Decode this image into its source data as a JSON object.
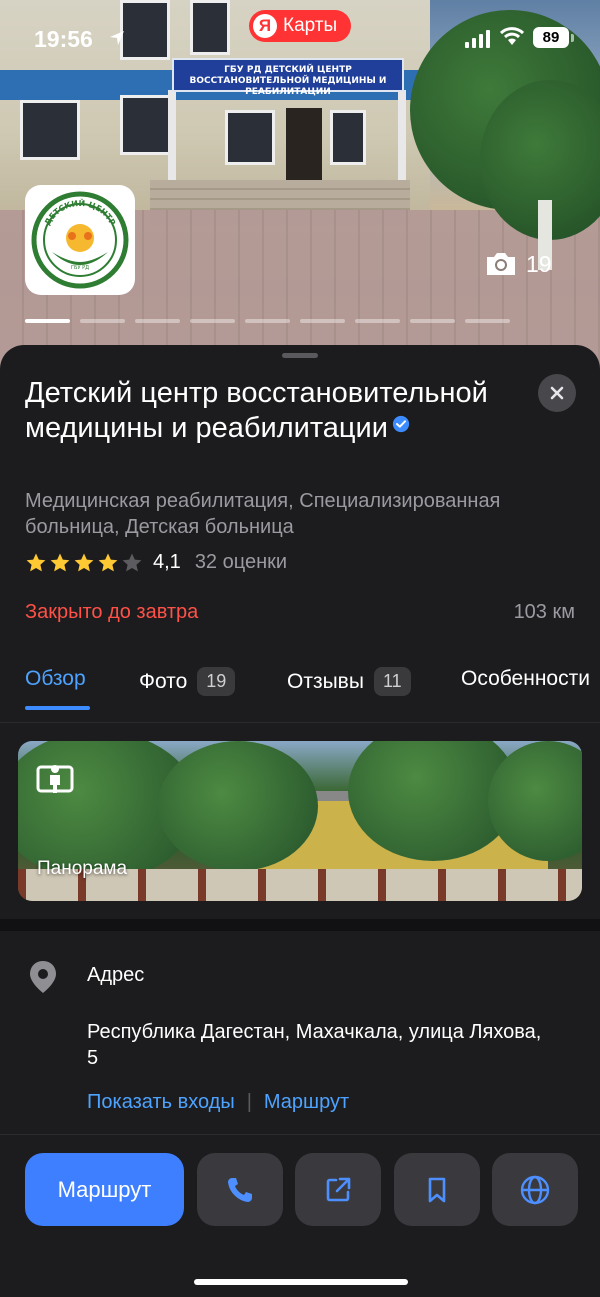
{
  "status_bar": {
    "time": "19:56",
    "app_pill": {
      "logo": "Я",
      "label": "Карты"
    },
    "battery": "89"
  },
  "hero": {
    "sign_text": "ГБУ РД ДЕТСКИЙ ЦЕНТР ВОССТАНОВИТЕЛЬНОЙ МЕДИЦИНЫ И РЕАБИЛИТАЦИИ",
    "logo_text": "ДЕТСКИЙ ЦЕНТР",
    "logo_subtext": "ГБУ РД",
    "photo_count": "19"
  },
  "place": {
    "title": "Детский центр восстановительной медицины и реабилитации",
    "categories": "Медицинская реабилитация, Специализированная больница, Детская больница",
    "rating": "4,1",
    "rating_count": "32 оценки",
    "rating_stars": 4,
    "status": "Закрыто до завтра",
    "distance": "103 км",
    "colors": {
      "accent": "#3d7fff",
      "closed": "#ff5147",
      "link": "#4da3ff",
      "star": "#ffc933"
    }
  },
  "tabs": [
    {
      "label": "Обзор",
      "badge": ""
    },
    {
      "label": "Фото",
      "badge": "19"
    },
    {
      "label": "Отзывы",
      "badge": "11"
    },
    {
      "label": "Особенности",
      "badge": ""
    }
  ],
  "panorama": {
    "label": "Панорама",
    "icon": "panorama-icon"
  },
  "address": {
    "label": "Адрес",
    "text": "Республика Дагестан, Махачкала, улица Ляхова, 5",
    "link_entrances": "Показать входы",
    "link_route": "Маршрут"
  },
  "actions": {
    "route_label": "Маршрут",
    "icons": [
      "phone-icon",
      "share-icon",
      "bookmark-icon",
      "globe-icon"
    ]
  }
}
